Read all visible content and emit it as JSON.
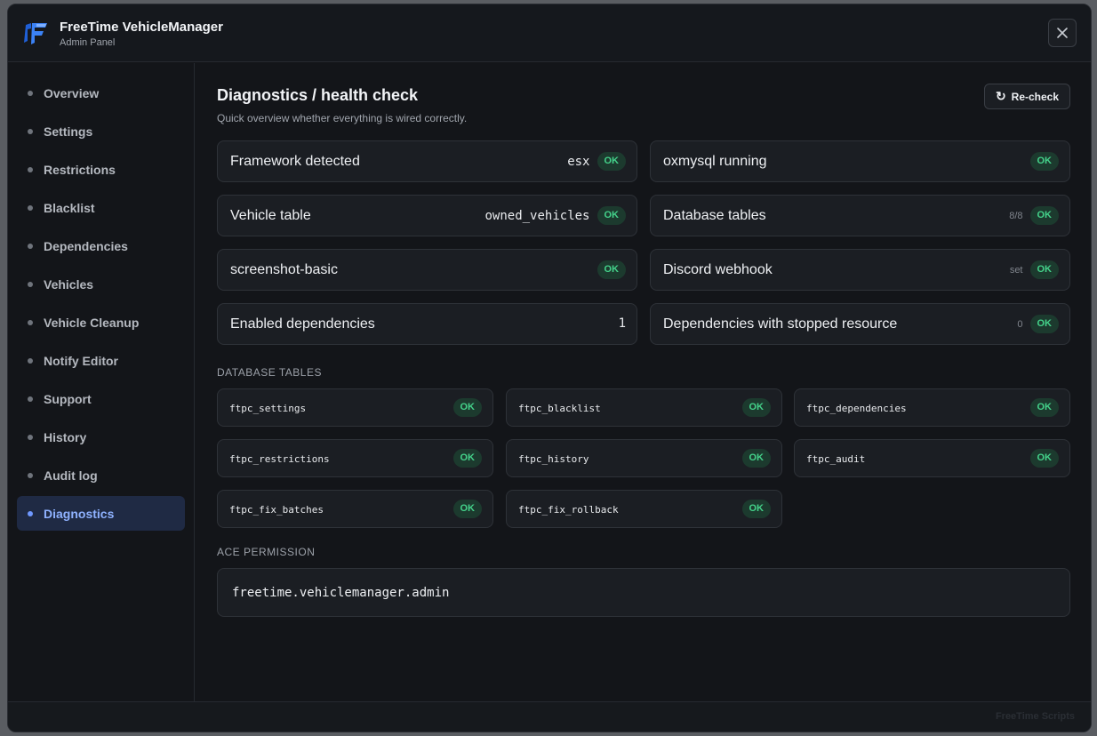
{
  "app": {
    "title": "FreeTime VehicleManager",
    "subtitle": "Admin Panel",
    "close_icon": "close-icon"
  },
  "sidebar": {
    "items": [
      {
        "label": "Overview"
      },
      {
        "label": "Settings"
      },
      {
        "label": "Restrictions"
      },
      {
        "label": "Blacklist"
      },
      {
        "label": "Dependencies"
      },
      {
        "label": "Vehicles"
      },
      {
        "label": "Vehicle Cleanup"
      },
      {
        "label": "Notify Editor"
      },
      {
        "label": "Support"
      },
      {
        "label": "History"
      },
      {
        "label": "Audit log"
      },
      {
        "label": "Diagnostics"
      }
    ],
    "active": "Diagnostics"
  },
  "page": {
    "title": "Diagnostics / health check",
    "subtitle": "Quick overview whether everything is wired correctly.",
    "recheck_label": "Re-check"
  },
  "checks": [
    {
      "label": "Framework detected",
      "value": "esx",
      "status": "OK"
    },
    {
      "label": "oxmysql running",
      "status": "OK"
    },
    {
      "label": "Vehicle table",
      "value": "owned_vehicles",
      "status": "OK"
    },
    {
      "label": "Database tables",
      "detail": "8/8",
      "status": "OK"
    },
    {
      "label": "screenshot-basic",
      "status": "OK"
    },
    {
      "label": "Discord webhook",
      "detail": "set",
      "status": "OK"
    },
    {
      "label": "Enabled dependencies",
      "value": "1"
    },
    {
      "label": "Dependencies with stopped resource",
      "detail": "0",
      "status": "OK"
    }
  ],
  "db_section_label": "DATABASE TABLES",
  "db_tables": [
    {
      "name": "ftpc_settings",
      "status": "OK"
    },
    {
      "name": "ftpc_blacklist",
      "status": "OK"
    },
    {
      "name": "ftpc_dependencies",
      "status": "OK"
    },
    {
      "name": "ftpc_restrictions",
      "status": "OK"
    },
    {
      "name": "ftpc_history",
      "status": "OK"
    },
    {
      "name": "ftpc_audit",
      "status": "OK"
    },
    {
      "name": "ftpc_fix_batches",
      "status": "OK"
    },
    {
      "name": "ftpc_fix_rollback",
      "status": "OK"
    }
  ],
  "ace_section_label": "ACE PERMISSION",
  "ace_permission": "freetime.vehiclemanager.admin",
  "footer": {
    "brand": "FreeTime Scripts"
  },
  "colors": {
    "accent": "#6f98ff",
    "ok_bg": "#1c3a2e",
    "ok_text": "#44d28a",
    "background": "#131519"
  }
}
